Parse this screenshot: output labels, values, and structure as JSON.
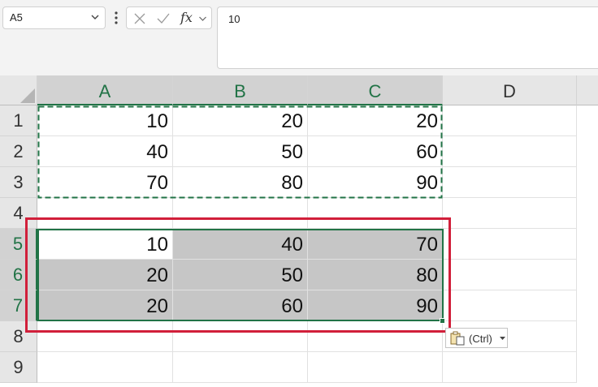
{
  "formula_bar": {
    "name_box": "A5",
    "fx_label": "fx",
    "formula": "10"
  },
  "columns": [
    "A",
    "B",
    "C",
    "D"
  ],
  "rows": [
    "1",
    "2",
    "3",
    "4",
    "5",
    "6",
    "7",
    "8",
    "9"
  ],
  "cells": {
    "A1": "10",
    "B1": "20",
    "C1": "20",
    "A2": "40",
    "B2": "50",
    "C2": "60",
    "A3": "70",
    "B3": "80",
    "C3": "90",
    "A5": "10",
    "B5": "40",
    "C5": "70",
    "A6": "20",
    "B6": "50",
    "C6": "80",
    "A7": "20",
    "B7": "60",
    "C7": "90"
  },
  "paste_options": {
    "label": "(Ctrl)"
  },
  "colors": {
    "selection": "#217346",
    "highlight_box": "#d11f3a",
    "selected_fill": "#c6c6c6"
  }
}
